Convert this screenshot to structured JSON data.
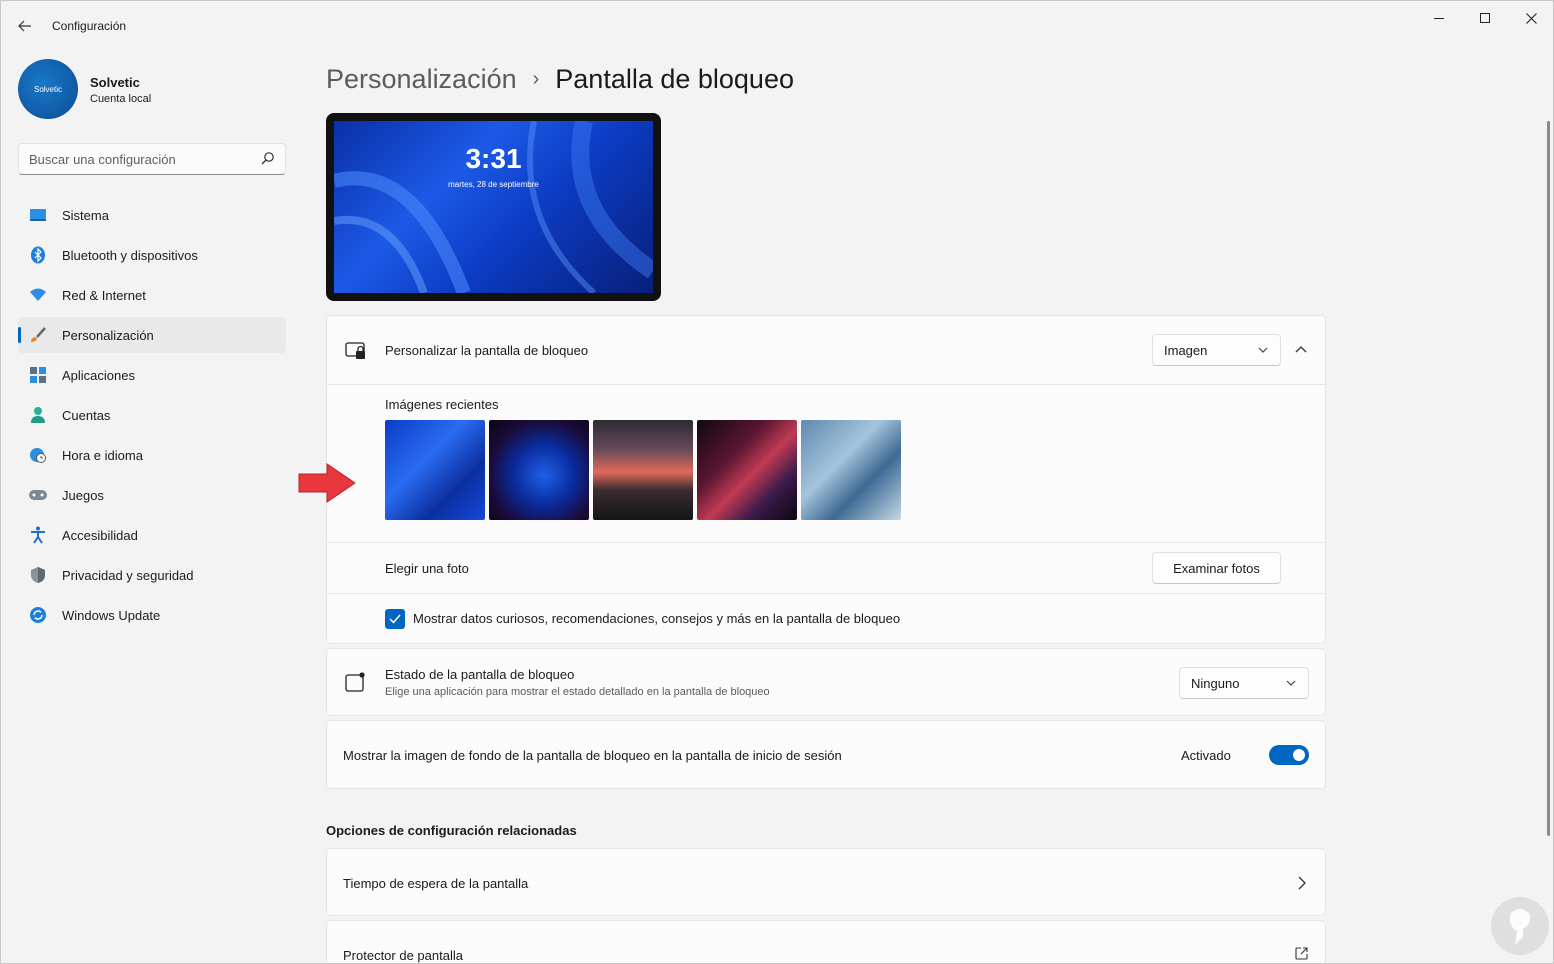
{
  "window": {
    "title": "Configuración"
  },
  "profile": {
    "name": "Solvetic",
    "account_type": "Cuenta local",
    "avatar_text": "Solvetic"
  },
  "search": {
    "placeholder": "Buscar una configuración"
  },
  "sidebar": {
    "items": [
      {
        "label": "Sistema",
        "icon": "monitor-icon"
      },
      {
        "label": "Bluetooth y dispositivos",
        "icon": "bluetooth-icon"
      },
      {
        "label": "Red & Internet",
        "icon": "wifi-icon"
      },
      {
        "label": "Personalización",
        "icon": "brush-icon",
        "active": true
      },
      {
        "label": "Aplicaciones",
        "icon": "apps-icon"
      },
      {
        "label": "Cuentas",
        "icon": "person-icon"
      },
      {
        "label": "Hora e idioma",
        "icon": "globe-clock-icon"
      },
      {
        "label": "Juegos",
        "icon": "gamepad-icon"
      },
      {
        "label": "Accesibilidad",
        "icon": "accessibility-icon"
      },
      {
        "label": "Privacidad y seguridad",
        "icon": "shield-icon"
      },
      {
        "label": "Windows Update",
        "icon": "update-icon"
      }
    ]
  },
  "breadcrumb": {
    "parent": "Personalización",
    "separator": "›",
    "current": "Pantalla de bloqueo"
  },
  "preview": {
    "time": "3:31",
    "date": "martes, 28 de septiembre"
  },
  "lock_screen": {
    "label": "Personalizar la pantalla de bloqueo",
    "dropdown_value": "Imagen",
    "recent_label": "Imágenes recientes",
    "choose_photo_label": "Elegir una foto",
    "browse_button": "Examinar fotos",
    "fun_facts_label": "Mostrar datos curiosos, recomendaciones, consejos y más en la pantalla de bloqueo",
    "fun_facts_checked": true
  },
  "lock_status": {
    "label": "Estado de la pantalla de bloqueo",
    "description": "Elige una aplicación para mostrar el estado detallado en la pantalla de bloqueo",
    "dropdown_value": "Ninguno"
  },
  "signin_background": {
    "label": "Mostrar la imagen de fondo de la pantalla de bloqueo en la pantalla de inicio de sesión",
    "state_text": "Activado",
    "enabled": true
  },
  "related": {
    "title": "Opciones de configuración relacionadas",
    "items": [
      {
        "label": "Tiempo de espera de la pantalla",
        "icon": "chevron-right-icon"
      },
      {
        "label": "Protector de pantalla",
        "icon": "open-external-icon"
      }
    ]
  },
  "colors": {
    "accent": "#0067c0",
    "annotation_arrow": "#e8383d"
  }
}
